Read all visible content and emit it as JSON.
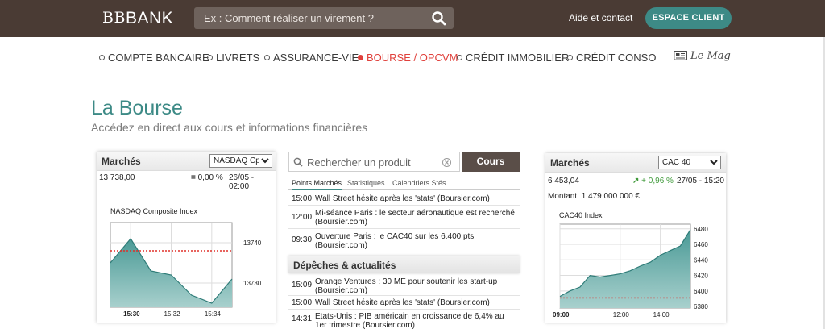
{
  "header": {
    "logo_text": "BANK",
    "logo_mark": "BB",
    "search_placeholder": "Ex : Comment réaliser un virement ?",
    "help_link": "Aide et contact",
    "client_button": "ESPACE CLIENT"
  },
  "nav": {
    "items": [
      {
        "label": "COMPTE BANCAIRE",
        "active": false
      },
      {
        "label": "LIVRETS",
        "active": false
      },
      {
        "label": "ASSURANCE-VIE",
        "active": false
      },
      {
        "label": "BOURSE / OPCVM",
        "active": true
      },
      {
        "label": "CRÉDIT IMMOBILIER",
        "active": false
      },
      {
        "label": "CRÉDIT CONSO",
        "active": false
      }
    ],
    "mag": "Le Mag",
    "active_color": "#e0413c"
  },
  "page": {
    "title": "La Bourse",
    "subtitle": "Accédez en direct aux cours et informations financières",
    "accent_color": "#3d8a86"
  },
  "left_widget": {
    "heading": "Marchés",
    "select_value": "NASDAQ Cp",
    "value": "13 738,00",
    "change": "0,00 %",
    "change_icon": "equal-icon",
    "datetime": "26/05 - 02:00",
    "chart_title": "NASDAQ Composite Index",
    "y_ticks": [
      "13740",
      "13730"
    ],
    "x_ticks": [
      "15:30",
      "15:32",
      "15:34"
    ]
  },
  "center": {
    "search_placeholder": "Rechercher un produit",
    "cours_button": "Cours",
    "tabs": [
      "Points Marchés",
      "Statistiques",
      "Calendriers Stés"
    ],
    "points": [
      {
        "time": "15:00",
        "text": "Wall Street hésite après les 'stats' (Boursier.com)"
      },
      {
        "time": "12:00",
        "text": "Mi-séance Paris : le secteur aéronautique est recherché (Boursier.com)"
      },
      {
        "time": "09:30",
        "text": "Ouverture Paris : le CAC40 sur les 6.400 pts (Boursier.com)"
      }
    ],
    "depeches_heading": "Dépêches & actualités",
    "depeches": [
      {
        "time": "15:09",
        "text": "Orange Ventures : 30 ME pour soutenir les start-up (Boursier.com)"
      },
      {
        "time": "15:00",
        "text": "Wall Street hésite après les 'stats' (Boursier.com)"
      },
      {
        "time": "14:31",
        "text": "Etats-Unis : PIB américain en croissance de 6,4% au 1er trimestre (Boursier.com)"
      }
    ]
  },
  "right_widget": {
    "heading": "Marchés",
    "select_value": "CAC 40",
    "value": "6 453,04",
    "change": "+ 0,96 %",
    "change_icon": "up-arrow-icon",
    "change_color": "#3f9a3a",
    "datetime": "27/05 - 15:20",
    "amount": "Montant: 1 479 000 000 €",
    "chart_title": "CAC40 Index",
    "y_ticks": [
      "6480",
      "6460",
      "6440",
      "6420",
      "6400",
      "6380"
    ],
    "x_ticks": [
      "09:00",
      "12:00",
      "14:00"
    ]
  },
  "chart_data": [
    {
      "type": "area",
      "title": "NASDAQ Composite Index",
      "x": [
        "15:29",
        "15:30",
        "15:31",
        "15:32",
        "15:33",
        "15:34",
        "15:35"
      ],
      "series": [
        {
          "values": [
            13735,
            13741,
            13733,
            13732,
            13727,
            13725,
            13731
          ]
        }
      ],
      "reference_line": 13738,
      "ylim": [
        13724,
        13745
      ],
      "y_ticks": [
        13740,
        13730
      ],
      "x_ticks": [
        "15:30",
        "15:32",
        "15:34"
      ],
      "grid": true
    },
    {
      "type": "area",
      "title": "CAC40 Index",
      "x": [
        "09:00",
        "09:30",
        "10:00",
        "10:30",
        "11:00",
        "11:30",
        "12:00",
        "12:30",
        "13:00",
        "13:30",
        "14:00",
        "14:30",
        "15:00",
        "15:20"
      ],
      "series": [
        {
          "values": [
            6393,
            6400,
            6405,
            6420,
            6418,
            6420,
            6422,
            6426,
            6432,
            6437,
            6446,
            6452,
            6458,
            6479
          ]
        }
      ],
      "reference_line": 6391,
      "ylim": [
        6378,
        6486
      ],
      "y_ticks": [
        6480,
        6460,
        6440,
        6420,
        6400,
        6380
      ],
      "x_ticks": [
        "09:00",
        "12:00",
        "14:00"
      ],
      "grid": true
    }
  ]
}
